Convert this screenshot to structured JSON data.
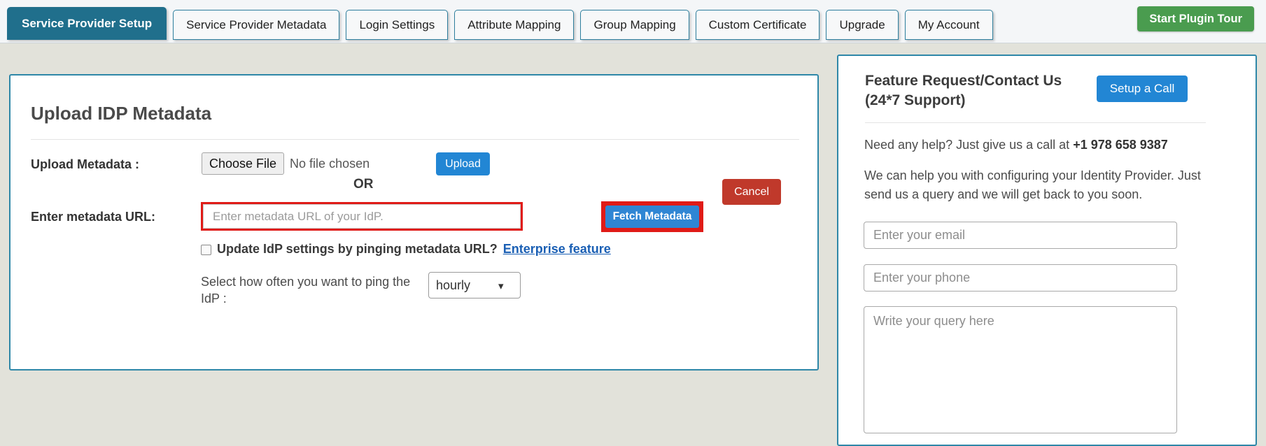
{
  "tabbar": {
    "tabs": [
      {
        "label": "Service Provider Setup",
        "active": true
      },
      {
        "label": "Service Provider Metadata",
        "active": false
      },
      {
        "label": "Login Settings",
        "active": false
      },
      {
        "label": "Attribute Mapping",
        "active": false
      },
      {
        "label": "Group Mapping",
        "active": false
      },
      {
        "label": "Custom Certificate",
        "active": false
      },
      {
        "label": "Upgrade",
        "active": false
      },
      {
        "label": "My Account",
        "active": false
      }
    ],
    "tour_button": "Start Plugin Tour"
  },
  "main": {
    "title": "Upload IDP Metadata",
    "cancel_label": "Cancel",
    "upload_metadata_label": "Upload Metadata :",
    "choose_file_label": "Choose File",
    "no_file_text": "No file chosen",
    "upload_label": "Upload",
    "or_text": "OR",
    "metadata_url_label": "Enter metadata URL:",
    "metadata_url_value": "",
    "metadata_url_placeholder": "Enter metadata URL of your IdP.",
    "fetch_label": "Fetch Metadata",
    "ping_checkbox_checked": false,
    "ping_text": "Update IdP settings by pinging metadata URL?",
    "enterprise_link": "Enterprise feature",
    "frequency_label": "Select how often you want to ping the IdP :",
    "frequency_value": "hourly",
    "frequency_options": [
      "hourly"
    ],
    "select_caret_icon": "chevron-down-icon"
  },
  "sidebar": {
    "title": "Feature Request/Contact Us (24*7 Support)",
    "setup_call_label": "Setup a Call",
    "help_prefix": "Need any help? Just give us a call at ",
    "phone": "+1 978 658 9387",
    "description": "We can help you with configuring your Identity Provider. Just send us a query and we will get back to you soon.",
    "email_value": "",
    "email_placeholder": "Enter your email",
    "phone_value": "",
    "phone_placeholder": "Enter your phone",
    "query_value": "",
    "query_placeholder": "Write your query here"
  },
  "colors": {
    "active_tab": "#206f8c",
    "tour_green": "#4a9c4f",
    "cancel_red": "#c0392b",
    "primary_blue": "#2286d4",
    "highlight_red": "#e01b17",
    "card_border": "#2e87a8",
    "page_bg": "#e2e2da"
  }
}
